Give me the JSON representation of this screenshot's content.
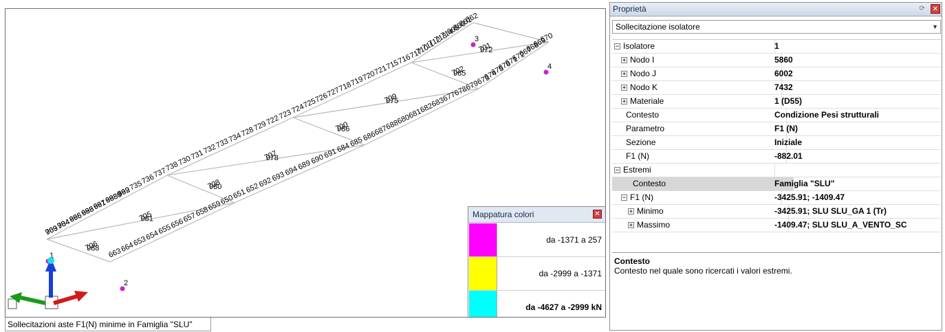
{
  "viewport": {
    "status_text": "Sollecitazioni aste F1(N) minime in Famiglia \"SLU\"",
    "element_labels": [
      "981",
      "988",
      "978",
      "980",
      "975",
      "986",
      "972",
      "985",
      "969",
      "984",
      "966",
      "983",
      "961",
      "9880",
      "962",
      "735",
      "736",
      "737",
      "738",
      "730",
      "731",
      "732",
      "733",
      "734",
      "728",
      "729",
      "722",
      "723",
      "724",
      "725",
      "726",
      "727",
      "718",
      "719",
      "720",
      "721",
      "715",
      "716",
      "717",
      "710",
      "711",
      "712",
      "713",
      "714",
      "665",
      "660",
      "661",
      "662",
      "663",
      "664",
      "653",
      "654",
      "655",
      "656",
      "657",
      "658",
      "659",
      "650",
      "651",
      "652",
      "692",
      "693",
      "694",
      "689",
      "690",
      "691",
      "684",
      "685",
      "686",
      "687",
      "688",
      "680",
      "681",
      "682",
      "683",
      "677",
      "678",
      "679",
      "673",
      "674",
      "675",
      "676",
      "671",
      "672",
      "667",
      "668",
      "669",
      "670",
      "705",
      "706",
      "707",
      "708",
      "709",
      "700",
      "701",
      "702",
      "703",
      "704",
      "695",
      "696",
      "697",
      "698",
      "699"
    ],
    "node_labels": [
      "1",
      "2",
      "3",
      "4"
    ],
    "node_color": "#cc22cc",
    "axis_colors": {
      "z": "#1a3fd6",
      "x": "#d11a1a",
      "y": "#1b9a1b"
    }
  },
  "legend": {
    "title": "Mappatura colori",
    "rows": [
      {
        "color": "#ff00ff",
        "label": "da -1371 a 257",
        "bold": false
      },
      {
        "color": "#ffff00",
        "label": "da -2999 a -1371",
        "bold": false
      },
      {
        "color": "#00ffff",
        "label": "da -4627 a -2999 kN",
        "bold": true
      }
    ]
  },
  "properties": {
    "title": "Proprietà",
    "selector_value": "Sollecitazione isolatore",
    "rows": [
      {
        "name": "Isolatore",
        "value": "1",
        "indent": 0,
        "expander": "minus",
        "group": true
      },
      {
        "name": "Nodo I",
        "value": "5860",
        "indent": 1,
        "expander": "plus"
      },
      {
        "name": "Nodo J",
        "value": "6002",
        "indent": 1,
        "expander": "plus"
      },
      {
        "name": "Nodo K",
        "value": "7432",
        "indent": 1,
        "expander": "plus"
      },
      {
        "name": "Materiale",
        "value": "1 (D55)",
        "indent": 1,
        "expander": "plus"
      },
      {
        "name": "Contesto",
        "value": "Condizione Pesi strutturali",
        "indent": 1,
        "expander": ""
      },
      {
        "name": "Parametro",
        "value": "F1 (N)",
        "indent": 1,
        "expander": ""
      },
      {
        "name": "Sezione",
        "value": "Iniziale",
        "indent": 1,
        "expander": ""
      },
      {
        "name": "F1 (N)",
        "value": "-882.01",
        "indent": 1,
        "expander": ""
      },
      {
        "name": "Estremi",
        "value": "",
        "indent": 0,
        "expander": "minus",
        "group": true
      },
      {
        "name": "Contesto",
        "value": "Famiglia \"SLU\"",
        "indent": 2,
        "expander": "",
        "selected": true
      },
      {
        "name": "F1 (N)",
        "value": "-3425.91; -1409.47",
        "indent": 1,
        "expander": "minus"
      },
      {
        "name": "Minimo",
        "value": "-3425.91; SLU SLU_GA 1 (Tr)",
        "indent": 2,
        "expander": "plus"
      },
      {
        "name": "Massimo",
        "value": "-1409.47; SLU SLU_A_VENTO_SC",
        "indent": 2,
        "expander": "plus"
      }
    ],
    "description": {
      "title": "Contesto",
      "text": "Contesto nel quale sono ricercati i valori estremi."
    }
  }
}
